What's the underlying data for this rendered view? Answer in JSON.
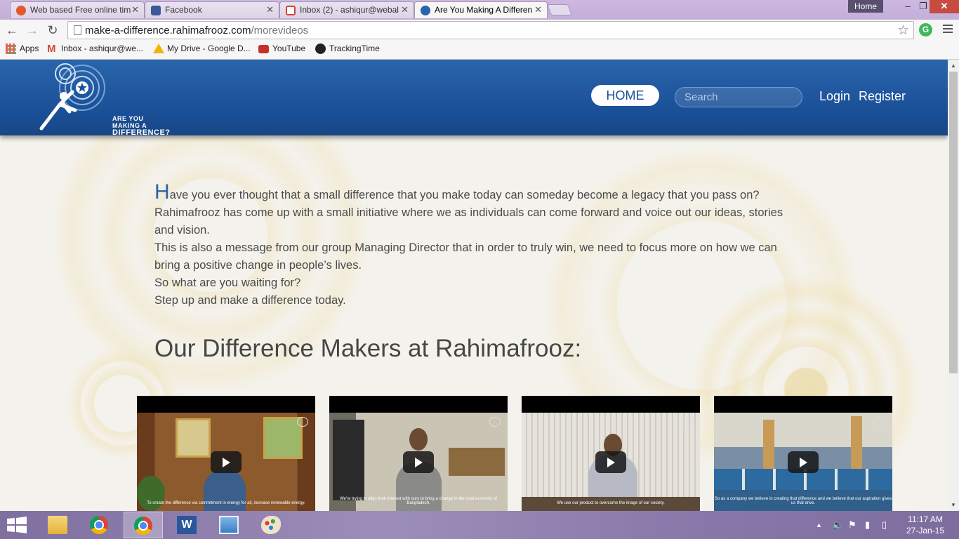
{
  "browser": {
    "tabs": [
      {
        "title": "Web based Free online tim",
        "favicon": "timer-icon",
        "color": "#e05a2b"
      },
      {
        "title": "Facebook",
        "favicon": "facebook-icon",
        "color": "#3b5998"
      },
      {
        "title": "Inbox (2) - ashiqur@webal",
        "favicon": "gmail-icon",
        "color": "#d44638"
      },
      {
        "title": "Are You Making A Differen",
        "favicon": "rahimafrooz-icon",
        "color": "#2a65ac"
      }
    ],
    "window_home": "Home",
    "window_controls": {
      "minimize": "–",
      "maximize": "❐",
      "close": "✕"
    },
    "url_host": "make-a-difference.rahimafrooz.com",
    "url_path": "/morevideos",
    "bookmarks": [
      {
        "label": "Apps",
        "icon": "apps-grid-icon"
      },
      {
        "label": "Inbox - ashiqur@we...",
        "icon": "gmail-icon"
      },
      {
        "label": "My Drive - Google D...",
        "icon": "google-drive-icon"
      },
      {
        "label": "YouTube",
        "icon": "youtube-icon"
      },
      {
        "label": "TrackingTime",
        "icon": "trackingtime-icon"
      }
    ]
  },
  "site": {
    "logo_line1": "ARE YOU MAKING A",
    "logo_line2": "DIFFERENCE?",
    "nav": {
      "home": "HOME",
      "search_placeholder": "Search",
      "login": "Login",
      "register": "Register"
    },
    "intro": {
      "dropcap": "H",
      "line1": "ave you ever thought that a small difference that you make today can someday become a legacy that you pass on?",
      "para2": "Rahimafrooz has come up with a small initiative where we as individuals can come forward and voice out our ideas, stories and vision.",
      "para3": "This is also a message from our group Managing Director that in order to truly win, we need to focus more on how we can bring a positive change in people’s lives.",
      "para4": "So what are you waiting for?",
      "para5": "Step up and make a difference today."
    },
    "section_title": "Our Difference Makers at Rahimafrooz:",
    "videos": [
      {
        "caption": "To create the difference via commitment in energy for all, increase renewable energy.",
        "scene": "office-wood"
      },
      {
        "caption": "We're trying to align their interest with ours to bring a change in the rural economy of Bangladesh.",
        "scene": "office-cabinet"
      },
      {
        "caption": "We use our product to overcome the image of our society.",
        "scene": "office-blinds"
      },
      {
        "caption": "So as a company we believe in creating that difference and we believe that our aspiration gives us that drive.",
        "scene": "open-office"
      }
    ]
  },
  "taskbar": {
    "apps": [
      "file-explorer-icon",
      "chrome-icon",
      "chrome-icon",
      "word-icon",
      "photo-viewer-icon",
      "paint-icon"
    ],
    "time": "11:17 AM",
    "date": "27-Jan-15"
  },
  "colors": {
    "header_blue": "#1a4f97",
    "accent_blue": "#2a65ac",
    "taskbar_purple": "#8a7aab"
  }
}
